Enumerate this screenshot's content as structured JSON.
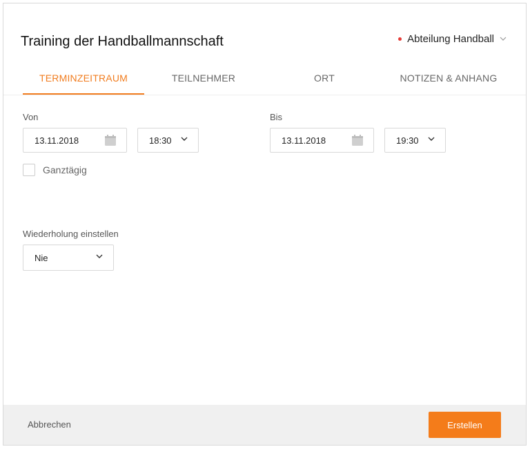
{
  "dialog": {
    "title": "Training der Handballmannschaft",
    "department": "Abteilung Handball"
  },
  "tabs": [
    {
      "label": "TERMINZEITRAUM",
      "active": true
    },
    {
      "label": "TEILNEHMER",
      "active": false
    },
    {
      "label": "ORT",
      "active": false
    },
    {
      "label": "NOTIZEN & ANHANG",
      "active": false
    }
  ],
  "from": {
    "label": "Von",
    "date": "13.11.2018",
    "time": "18:30"
  },
  "to": {
    "label": "Bis",
    "date": "13.11.2018",
    "time": "19:30"
  },
  "all_day": {
    "label": "Ganztägig",
    "checked": false
  },
  "repeat": {
    "label": "Wiederholung einstellen",
    "value": "Nie"
  },
  "footer": {
    "cancel_label": "Abbrechen",
    "create_label": "Erstellen"
  },
  "colors": {
    "accent": "#f47c1a",
    "status_dot": "#e53935"
  }
}
